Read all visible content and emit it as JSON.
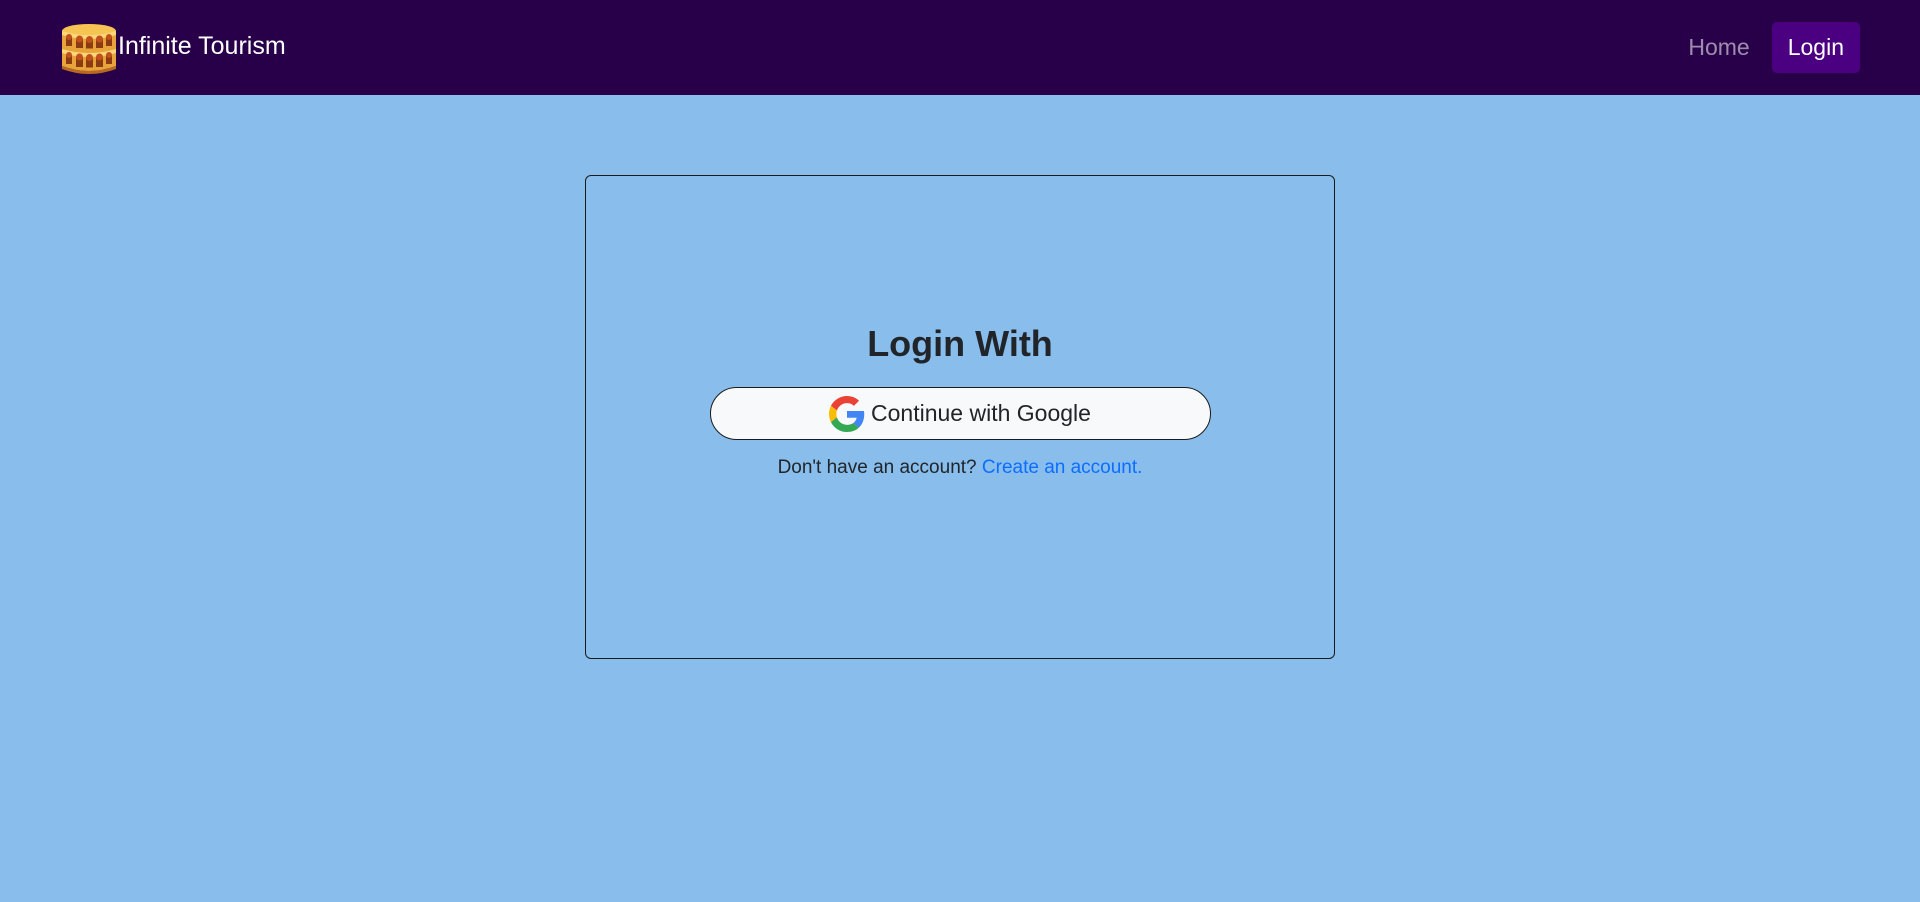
{
  "navbar": {
    "brand_name": "Infinite Tourism",
    "logo_icon": "colosseum-icon",
    "links": {
      "home": "Home",
      "login": "Login"
    },
    "colors": {
      "background": "#28004a",
      "login_button": "#4b0082"
    }
  },
  "login_card": {
    "title": "Login With",
    "google_button": {
      "icon": "google-g-icon",
      "label": "Continue with Google"
    },
    "signup_prompt": "Don't have an account?",
    "signup_link": "Create an account."
  },
  "page": {
    "background_color": "#88bdec",
    "link_color": "#0d6efd"
  }
}
